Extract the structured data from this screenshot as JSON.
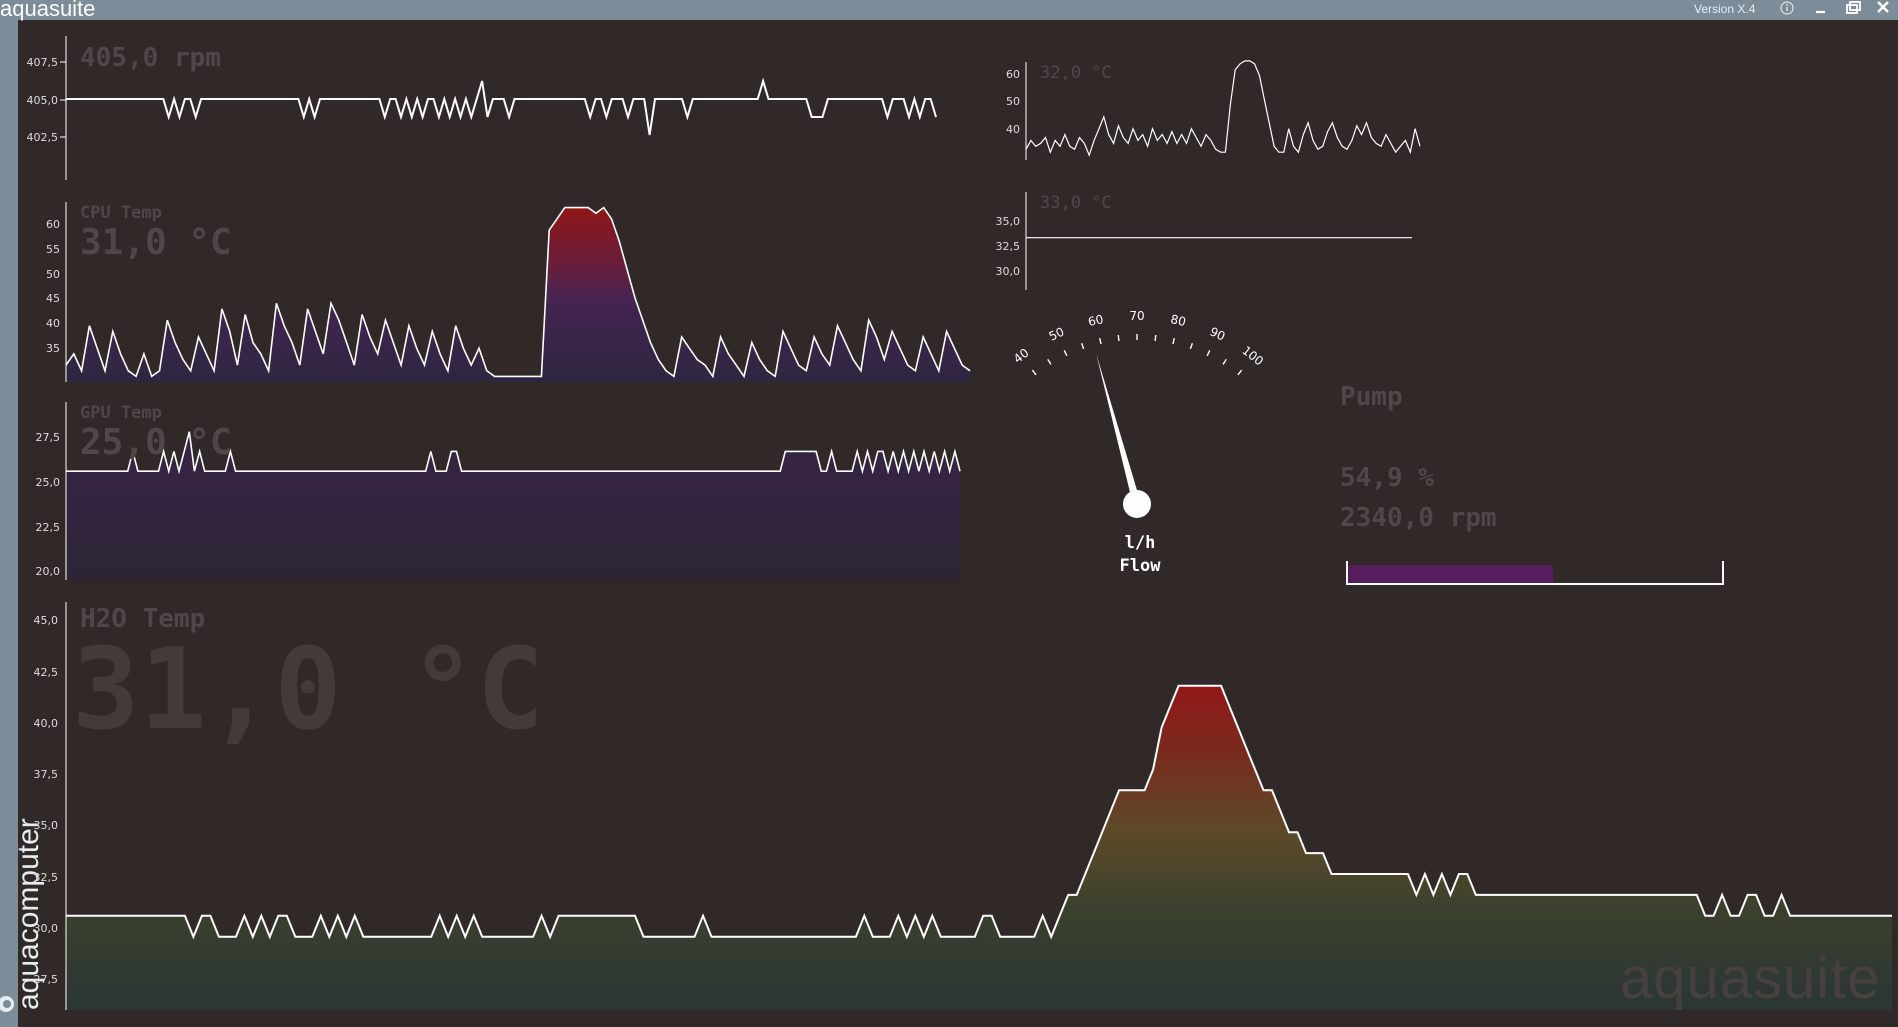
{
  "window": {
    "title": "aquasuite",
    "version": "Version X.4",
    "titlebar_color": "#7c8d99",
    "background_color": "#302928",
    "brand_side_label": "aquacomputer",
    "watermark": "aquasuite",
    "buttons": [
      "info-icon",
      "minimize-icon",
      "restore-icon",
      "close-icon"
    ]
  },
  "panels": {
    "fan": {
      "label": "",
      "value": "405,0 rpm",
      "ticks": [
        "407,5",
        "405,0",
        "402,5"
      ],
      "chart_data": {
        "type": "line",
        "ylim": [
          401.5,
          408.5
        ],
        "ylabel_ticks": [
          407.5,
          405.0,
          402.5
        ],
        "values": [
          405,
          405,
          405,
          405,
          405,
          405,
          405,
          405,
          405,
          405,
          405,
          405,
          405,
          405,
          405,
          405,
          405,
          405,
          405,
          404,
          405,
          404,
          405,
          405,
          404,
          405,
          405,
          405,
          405,
          405,
          405,
          405,
          405,
          405,
          405,
          405,
          405,
          405,
          405,
          405,
          405,
          405,
          405,
          405,
          404,
          405,
          404,
          405,
          405,
          405,
          405,
          405,
          405,
          405,
          405,
          405,
          405,
          405,
          405,
          404,
          405,
          405,
          404,
          405,
          404,
          405,
          404,
          405,
          405,
          404,
          405,
          404,
          405,
          404,
          405,
          404,
          405,
          406,
          404,
          405,
          405,
          405,
          404,
          405,
          405,
          405,
          405,
          405,
          405,
          405,
          405,
          405,
          405,
          405,
          405,
          405,
          405,
          404,
          405,
          405,
          404,
          405,
          405,
          405,
          404,
          405,
          405,
          405,
          403,
          405,
          405,
          405,
          405,
          405,
          405,
          404,
          405,
          405,
          405,
          405,
          405,
          405,
          405,
          405,
          405,
          405,
          405,
          405,
          405,
          406,
          405,
          405,
          405,
          405,
          405,
          405,
          405,
          405,
          404,
          404,
          404,
          405,
          405,
          405,
          405,
          405,
          405,
          405,
          405,
          405,
          405,
          405,
          404,
          405,
          405,
          405,
          404,
          405,
          404,
          405,
          405,
          404
        ]
      }
    },
    "cpu": {
      "label": "CPU Temp",
      "value": "31,0 °C",
      "ticks": [
        "60",
        "55",
        "50",
        "45",
        "40",
        "35"
      ],
      "chart_data": {
        "type": "area",
        "ylim": [
          31,
          63
        ],
        "values": [
          34,
          36,
          33,
          41,
          37,
          33,
          40,
          36,
          33,
          32,
          36,
          32,
          33,
          42,
          38,
          35,
          33,
          39,
          36,
          33,
          44,
          40,
          34,
          43,
          38,
          36,
          33,
          45,
          41,
          38,
          34,
          44,
          40,
          36,
          45,
          42,
          38,
          34,
          43,
          39,
          36,
          42,
          38,
          34,
          41,
          37,
          34,
          40,
          36,
          33,
          41,
          37,
          34,
          37,
          33,
          32,
          32,
          32,
          32,
          32,
          32,
          32,
          58,
          60,
          62,
          62,
          62,
          62,
          61,
          62,
          60,
          56,
          51,
          46,
          42,
          38,
          35,
          33,
          32,
          39,
          37,
          35,
          34,
          32,
          39,
          36,
          34,
          32,
          38,
          35,
          33,
          32,
          40,
          37,
          34,
          33,
          39,
          36,
          34,
          41,
          38,
          35,
          33,
          42,
          39,
          35,
          40,
          37,
          34,
          33,
          39,
          36,
          33,
          40,
          37,
          34,
          33
        ]
      }
    },
    "gpu": {
      "label": "GPU Temp",
      "value": "25,0 °C",
      "ticks": [
        "27,5",
        "25,0",
        "22,5",
        "20,0"
      ],
      "chart_data": {
        "type": "area",
        "ylim": [
          19.5,
          28.5
        ],
        "values": [
          25,
          25,
          25,
          25,
          25,
          25,
          25,
          25,
          25,
          25,
          25,
          25,
          25,
          26,
          25,
          25,
          25,
          25,
          25,
          26,
          25,
          26,
          25,
          26,
          27,
          25,
          26,
          25,
          25,
          25,
          25,
          25,
          26,
          25,
          25,
          25,
          25,
          25,
          25,
          25,
          25,
          25,
          25,
          25,
          25,
          25,
          25,
          25,
          25,
          25,
          25,
          25,
          25,
          25,
          25,
          25,
          25,
          25,
          25,
          25,
          25,
          25,
          25,
          25,
          25,
          25,
          25,
          25,
          25,
          25,
          25,
          26,
          25,
          25,
          25,
          26,
          26,
          25,
          25,
          25,
          25,
          25,
          25,
          25,
          25,
          25,
          25,
          25,
          25,
          25,
          25,
          25,
          25,
          25,
          25,
          25,
          25,
          25,
          25,
          25,
          25,
          25,
          25,
          25,
          25,
          25,
          25,
          25,
          25,
          25,
          25,
          25,
          25,
          25,
          25,
          25,
          25,
          25,
          25,
          25,
          25,
          25,
          25,
          25,
          25,
          25,
          25,
          25,
          25,
          25,
          25,
          25,
          25,
          25,
          25,
          25,
          25,
          25,
          25,
          25,
          26,
          26,
          26,
          26,
          26,
          26,
          26,
          25,
          25,
          26,
          25,
          25,
          25,
          25,
          26,
          25,
          26,
          25,
          26,
          26,
          25,
          26,
          25,
          26,
          25,
          26,
          25,
          26,
          25,
          26,
          25,
          26,
          25,
          26,
          25
        ]
      }
    },
    "temp1": {
      "label": "",
      "value": "32,0 °C",
      "ticks": [
        "60",
        "50",
        "40"
      ],
      "chart_data": {
        "type": "line",
        "ylim": [
          28,
          64
        ],
        "values": [
          33,
          36,
          34,
          35,
          37,
          32,
          36,
          34,
          38,
          34,
          33,
          37,
          35,
          31,
          36,
          40,
          44,
          38,
          35,
          41,
          37,
          35,
          40,
          36,
          38,
          34,
          40,
          36,
          38,
          35,
          39,
          35,
          38,
          35,
          40,
          37,
          34,
          38,
          36,
          33,
          32,
          32,
          48,
          60,
          62,
          63,
          63,
          62,
          58,
          50,
          42,
          34,
          32,
          32,
          40,
          34,
          32,
          38,
          42,
          36,
          33,
          34,
          39,
          42,
          37,
          34,
          33,
          36,
          41,
          38,
          42,
          37,
          35,
          34,
          38,
          35,
          32,
          34,
          36,
          32,
          40,
          34
        ]
      }
    },
    "temp2": {
      "label": "",
      "value": "33,0 °C",
      "ticks": [
        "35,0",
        "32,5",
        "30,0"
      ],
      "chart_data": {
        "type": "line",
        "ylim": [
          29,
          36.5
        ],
        "values": [
          33.0,
          33.0
        ]
      }
    },
    "flow": {
      "unit": "l/h",
      "label": "Flow",
      "scale_labels": [
        "40",
        "50",
        "60",
        "70",
        "80",
        "90",
        "100"
      ],
      "value": 58,
      "range": [
        40,
        100
      ]
    },
    "pump": {
      "label": "Pump",
      "percent": "54,9 %",
      "rpm": "2340,0 rpm",
      "fill_fraction": 0.549,
      "bar_color": "#561e5e"
    },
    "h2o": {
      "label": "H2O Temp",
      "value": "31,0 °C",
      "ticks": [
        "45,0",
        "42,5",
        "40,0",
        "37,5",
        "35,0",
        "32,5",
        "30,0",
        "27,5"
      ],
      "chart_data": {
        "type": "area",
        "ylim": [
          26.5,
          46
        ],
        "values": [
          31,
          31,
          31,
          31,
          31,
          31,
          31,
          31,
          31,
          31,
          31,
          31,
          31,
          31,
          31,
          30,
          31,
          31,
          30,
          30,
          30,
          31,
          30,
          31,
          30,
          31,
          31,
          30,
          30,
          30,
          31,
          30,
          31,
          30,
          31,
          30,
          30,
          30,
          30,
          30,
          30,
          30,
          30,
          30,
          31,
          30,
          31,
          30,
          31,
          30,
          30,
          30,
          30,
          30,
          30,
          30,
          31,
          30,
          31,
          31,
          31,
          31,
          31,
          31,
          31,
          31,
          31,
          31,
          30,
          30,
          30,
          30,
          30,
          30,
          30,
          31,
          30,
          30,
          30,
          30,
          30,
          30,
          30,
          30,
          30,
          30,
          30,
          30,
          30,
          30,
          30,
          30,
          30,
          30,
          31,
          30,
          30,
          30,
          31,
          30,
          31,
          30,
          31,
          30,
          30,
          30,
          30,
          30,
          31,
          31,
          30,
          30,
          30,
          30,
          30,
          31,
          30,
          31,
          32,
          32,
          33,
          34,
          35,
          36,
          37,
          37,
          37,
          37,
          38,
          40,
          41,
          42,
          42,
          42,
          42,
          42,
          42,
          41,
          40,
          39,
          38,
          37,
          37,
          36,
          35,
          35,
          34,
          34,
          34,
          33,
          33,
          33,
          33,
          33,
          33,
          33,
          33,
          33,
          33,
          32,
          33,
          32,
          33,
          32,
          33,
          33,
          32,
          32,
          32,
          32,
          32,
          32,
          32,
          32,
          32,
          32,
          32,
          32,
          32,
          32,
          32,
          32,
          32,
          32,
          32,
          32,
          32,
          32,
          32,
          32,
          32,
          32,
          32,
          31,
          31,
          32,
          31,
          31,
          32,
          32,
          31,
          31,
          32,
          31,
          31,
          31,
          31,
          31,
          31,
          31,
          31,
          31,
          31,
          31,
          31,
          31
        ]
      }
    }
  }
}
